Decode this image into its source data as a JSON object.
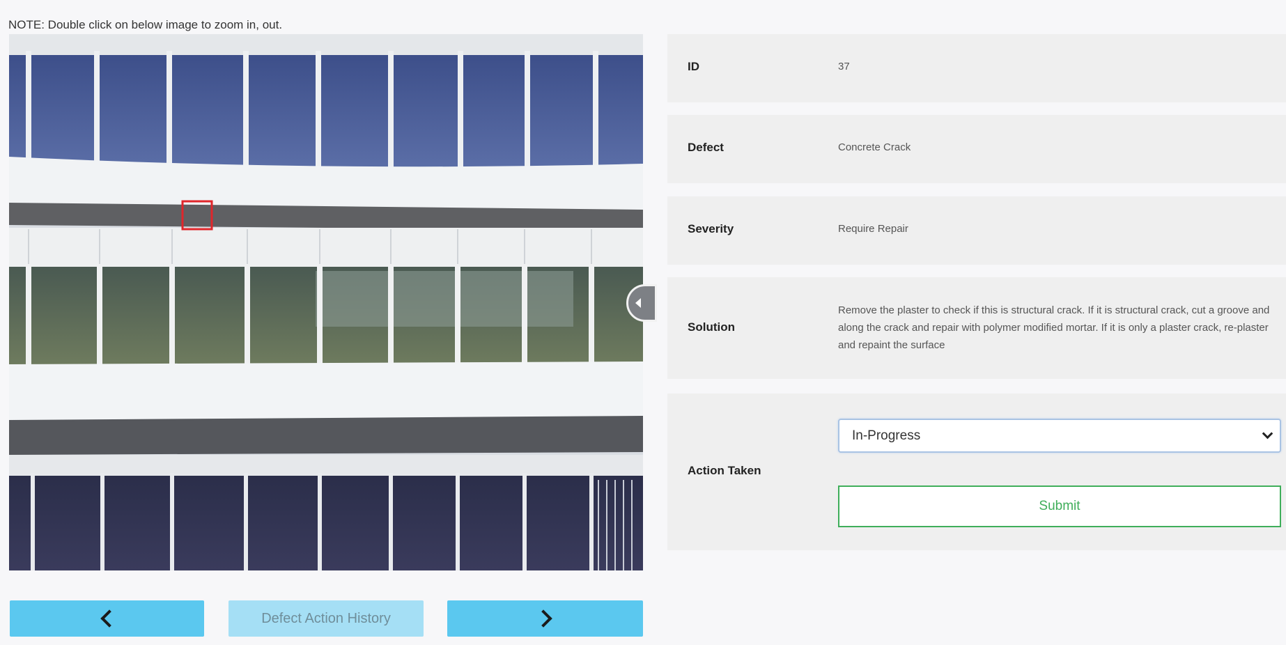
{
  "note": "NOTE: Double click on below image to zoom in, out.",
  "viewer": {
    "image_description": "building facade with defect marker",
    "handle_icon": "chevron-left-icon"
  },
  "buttons": {
    "prev_icon": "chevron-left-icon",
    "history_label": "Defect Action History",
    "next_icon": "chevron-right-icon"
  },
  "details": {
    "id_label": "ID",
    "id_value": "37",
    "defect_label": "Defect",
    "defect_value": "Concrete Crack",
    "severity_label": "Severity",
    "severity_value": "Require Repair",
    "solution_label": "Solution",
    "solution_value": "Remove the plaster to check if this is structural crack. If it is structural crack, cut a groove and along the crack and repair with polymer modified mortar. If it is only a plaster crack, re-plaster and repaint the surface",
    "action_label": "Action Taken",
    "action_selected": "In-Progress",
    "submit_label": "Submit"
  },
  "colors": {
    "nav_button": "#5bc8ef",
    "nav_button_disabled": "#a5dff5",
    "submit_border": "#3fae5a",
    "marker": "#e0262b"
  }
}
